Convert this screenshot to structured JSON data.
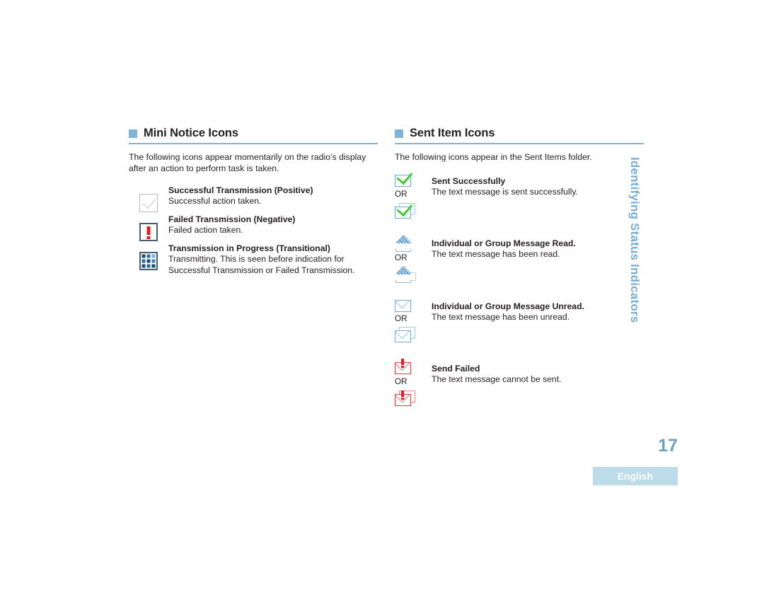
{
  "page": {
    "number": "17",
    "language_badge": "English",
    "side_title": "Identifying Status Indicators"
  },
  "left_section": {
    "heading": "Mini Notice Icons",
    "intro": "The following icons appear momentarily on the radio’s display after an action to perform task is taken.",
    "items": [
      {
        "icon": "successful-transmission-icon",
        "title": "Successful Transmission (Positive)",
        "desc": "Successful action taken."
      },
      {
        "icon": "failed-transmission-icon",
        "title": "Failed Transmission (Negative)",
        "desc": "Failed action taken."
      },
      {
        "icon": "transmission-in-progress-icon",
        "title": "Transmission in Progress (Transitional)",
        "desc": "Transmitting. This is seen before indication for Successful Transmission or Failed Transmission."
      }
    ]
  },
  "right_section": {
    "heading": "Sent Item Icons",
    "intro": "The following icons appear in the Sent Items folder.",
    "or_label": "OR",
    "items": [
      {
        "icon_primary": "sent-successfully-envelope-icon",
        "icon_alt": "sent-successfully-envelope-stack-icon",
        "title": "Sent Successfully",
        "desc": "The text message is sent successfully."
      },
      {
        "icon_primary": "message-read-envelope-icon",
        "icon_alt": "message-read-envelope-stack-icon",
        "title": "Individual or Group Message Read.",
        "desc": "The text message has been read."
      },
      {
        "icon_primary": "message-unread-envelope-icon",
        "icon_alt": "message-unread-envelope-stack-icon",
        "title": "Individual or Group Message Unread.",
        "desc": "The text message has been unread."
      },
      {
        "icon_primary": "send-failed-envelope-icon",
        "icon_alt": "send-failed-envelope-stack-icon",
        "title": "Send Failed",
        "desc": "The text message cannot be sent."
      }
    ]
  },
  "colors": {
    "accent_blue": "#7fb4d8",
    "rule_blue": "#7fb5d3",
    "side_title_blue": "#7aadd3",
    "page_number_blue": "#6f9fc4",
    "badge_bg": "#bcdcea",
    "tick_green": "#3fd130",
    "alert_red": "#d91f1f"
  },
  "dot_grid_colors": [
    "#1f4e6e",
    "#2f6f9c",
    "#6fb6e4",
    "#2f6f9c",
    "#1f4e6e",
    "#3f86b5",
    "#1f4e6e",
    "#2f6f9c",
    "#1f4e6e"
  ]
}
